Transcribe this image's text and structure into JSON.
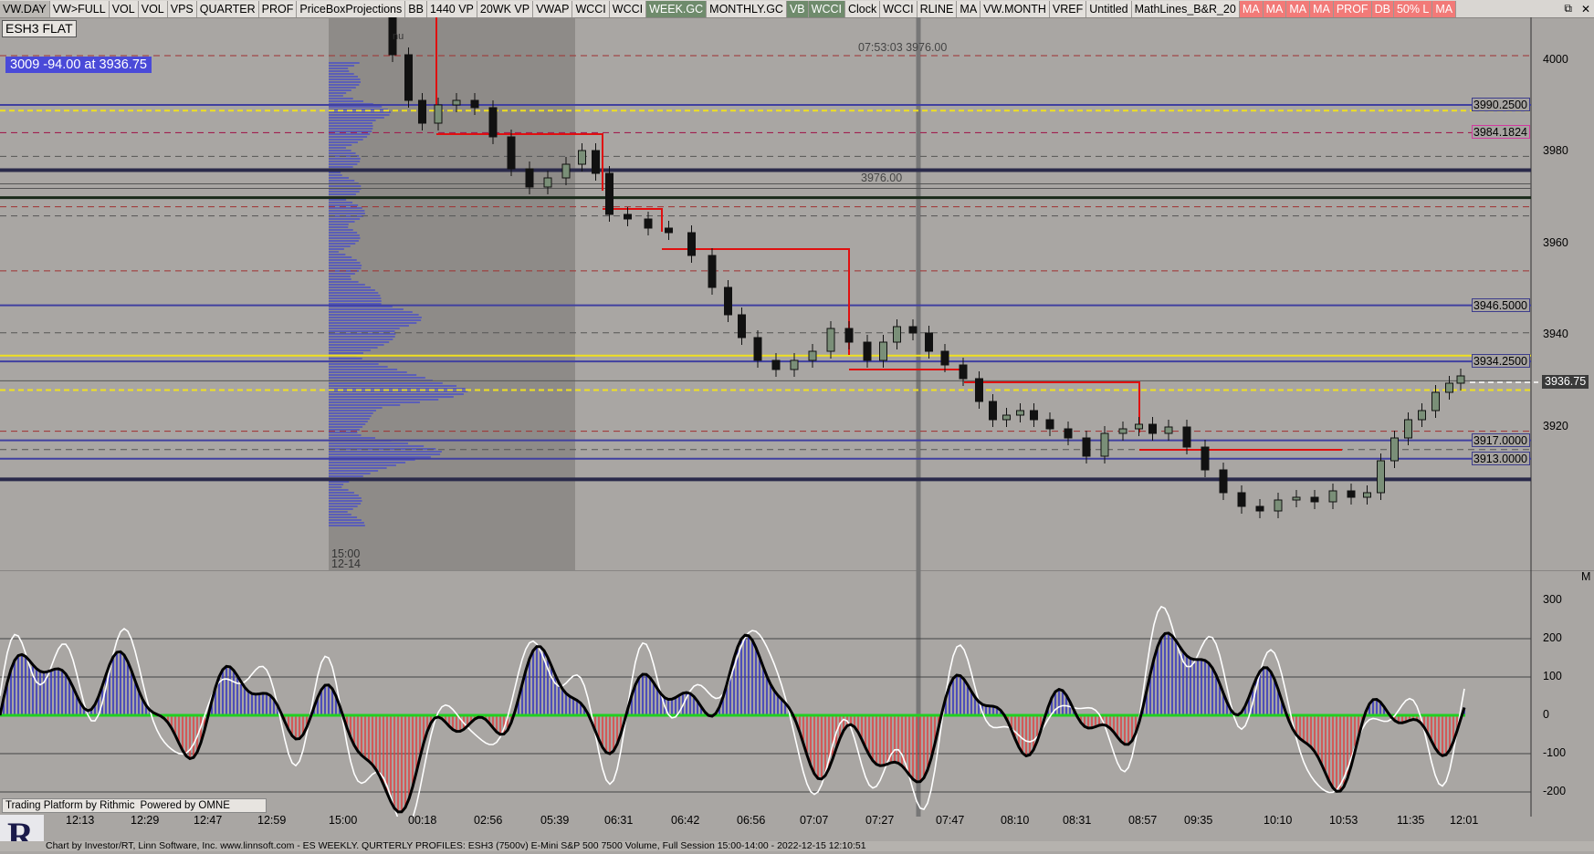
{
  "toolbar": {
    "buttons": [
      {
        "label": "VW.DAY",
        "style": "gray"
      },
      {
        "label": "VW>FULL",
        "style": ""
      },
      {
        "label": "VOL",
        "style": ""
      },
      {
        "label": "VOL",
        "style": ""
      },
      {
        "label": "VPS",
        "style": ""
      },
      {
        "label": "QUARTER",
        "style": ""
      },
      {
        "label": "PROF",
        "style": ""
      },
      {
        "label": "PriceBoxProjections",
        "style": ""
      },
      {
        "label": "BB",
        "style": ""
      },
      {
        "label": "1440 VP",
        "style": ""
      },
      {
        "label": "20WK VP",
        "style": ""
      },
      {
        "label": "VWAP",
        "style": ""
      },
      {
        "label": "WCCI",
        "style": ""
      },
      {
        "label": "WCCI",
        "style": ""
      },
      {
        "label": "WEEK.GC",
        "style": "green"
      },
      {
        "label": "MONTHLY.GC",
        "style": ""
      },
      {
        "label": "VB",
        "style": "green"
      },
      {
        "label": "WCCI",
        "style": "green"
      },
      {
        "label": "Clock",
        "style": ""
      },
      {
        "label": "WCCI",
        "style": ""
      },
      {
        "label": "RLINE",
        "style": ""
      },
      {
        "label": "MA",
        "style": ""
      },
      {
        "label": "VW.MONTH",
        "style": ""
      },
      {
        "label": "VREF",
        "style": ""
      },
      {
        "label": "Untitled",
        "style": ""
      },
      {
        "label": "MathLines_B&R_20",
        "style": ""
      },
      {
        "label": "MA",
        "style": "red"
      },
      {
        "label": "MA",
        "style": "red"
      },
      {
        "label": "MA",
        "style": "red"
      },
      {
        "label": "MA",
        "style": "red"
      },
      {
        "label": "PROF",
        "style": "red"
      },
      {
        "label": "DB",
        "style": "red"
      },
      {
        "label": "50% L",
        "style": "red"
      },
      {
        "label": "MA",
        "style": "red"
      }
    ]
  },
  "symbol": "ESH3 FLAT",
  "last_trade": "3009  -94.00 at 3936.75",
  "annotations": {
    "top_label": "07:53:03  3976.00",
    "mid_label": "3976.00",
    "profile_time": "15:00",
    "profile_date": "12-14",
    "partial_label": "nu"
  },
  "price_axis": {
    "ticks": [
      "4000",
      "3980",
      "3960",
      "3940",
      "3920"
    ],
    "levels": [
      "3990.2500",
      "3984.1824",
      "3946.5000",
      "3934.2500",
      "3917.0000",
      "3913.0000"
    ],
    "current_price": "3936.75"
  },
  "cci_axis": {
    "ticks": [
      "300",
      "200",
      "100",
      "0",
      "-100",
      "-200"
    ]
  },
  "time_axis": [
    "12:13",
    "12:29",
    "12:47",
    "12:59",
    "15:00",
    "00:18",
    "02:56",
    "05:39",
    "06:31",
    "06:42",
    "06:56",
    "07:07",
    "07:27",
    "07:47",
    "08:10",
    "08:31",
    "08:57",
    "09:35",
    "10:10",
    "10:53",
    "11:35",
    "12:01"
  ],
  "branding": {
    "rithmic": "Trading Platform by Rithmic",
    "omne": "Powered by OMNE",
    "footer": "Chart by Investor/RT, Linn Software, Inc. www.linnsoft.com - ES WEEKLY. QURTERLY PROFILES: ESH3 (7500v) E-Mini S&P 500 7500 Volume, Full Session 15:00-14:00 - 2022-12-15 12:10:51"
  },
  "window_controls": {
    "restore": "⧉",
    "close": "✕",
    "panel_marker": "M"
  },
  "colors": {
    "background": "#a9a6a3",
    "profile_shade": "#8a8785",
    "level_blue": "#4040a0",
    "level_yellow": "#f0e020",
    "level_red": "#c03030",
    "cci_positive": "#3030c0",
    "cci_negative": "#e04040",
    "cci_zero": "#20d020"
  }
}
